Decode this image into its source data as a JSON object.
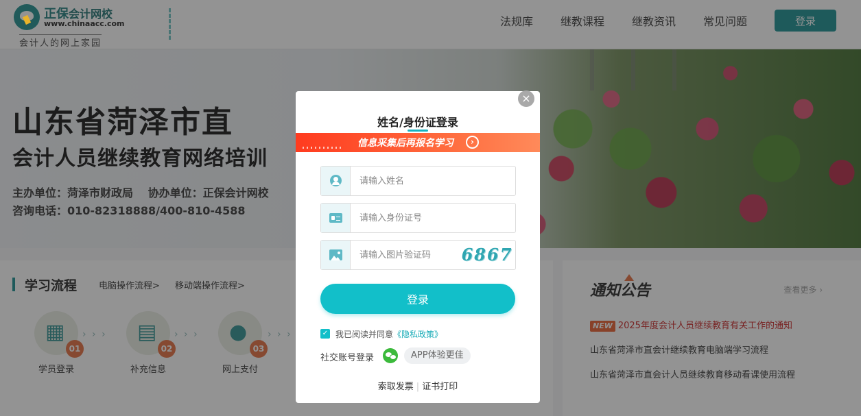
{
  "header": {
    "logo": {
      "brand_prefix": "正保",
      "brand_suffix": "会计网校",
      "url": "www.chinaacc.com",
      "slogan": "会计人的网上家园"
    },
    "nav": [
      "法规库",
      "继教课程",
      "继教资讯",
      "常见问题"
    ],
    "login_label": "登录"
  },
  "banner": {
    "title_line1": "山东省菏泽市直",
    "title_line2": "会计人员继续教育网络培训",
    "organizer": "主办单位：菏泽市财政局　 协办单位：正保会计网校",
    "hotline": "咨询电话：010-82318888/400-810-4588"
  },
  "process": {
    "title": "学习流程",
    "links": [
      "电脑操作流程>",
      "移动端操作流程>"
    ],
    "steps": [
      {
        "label": "学员登录",
        "num": "01",
        "icon": "calendar-icon"
      },
      {
        "label": "补充信息",
        "num": "02",
        "icon": "document-icon"
      },
      {
        "label": "网上支付",
        "num": "03",
        "icon": "user-icon"
      }
    ]
  },
  "notice": {
    "title": "通知公告",
    "more": "查看更多",
    "new_badge": "NEW",
    "items": [
      "2025年度会计人员继续教育有关工作的通知",
      "山东省菏泽市直会计继续教育电脑端学习流程",
      "山东省菏泽市直会计人员继续教育移动看课使用流程"
    ]
  },
  "modal": {
    "close": "×",
    "title": "姓名/身份证登录",
    "promo": "信息采集后再报名学习",
    "promo_arrow": "›",
    "name_placeholder": "请输入姓名",
    "id_placeholder": "请输入身份证号",
    "captcha_placeholder": "请输入图片验证码",
    "captcha_code": "6867",
    "submit": "登录",
    "agree_text": "我已阅读并同意",
    "privacy_link": "《隐私政策》",
    "social_label": "社交账号登录",
    "app_pill": "APP体验更佳",
    "footer": {
      "invoice": "索取发票",
      "certificate": "证书打印"
    }
  },
  "colors": {
    "accent": "#12bfc9",
    "brand": "#148c8f",
    "promo": "#ff4a28",
    "notice_hot": "#c81e1e"
  }
}
